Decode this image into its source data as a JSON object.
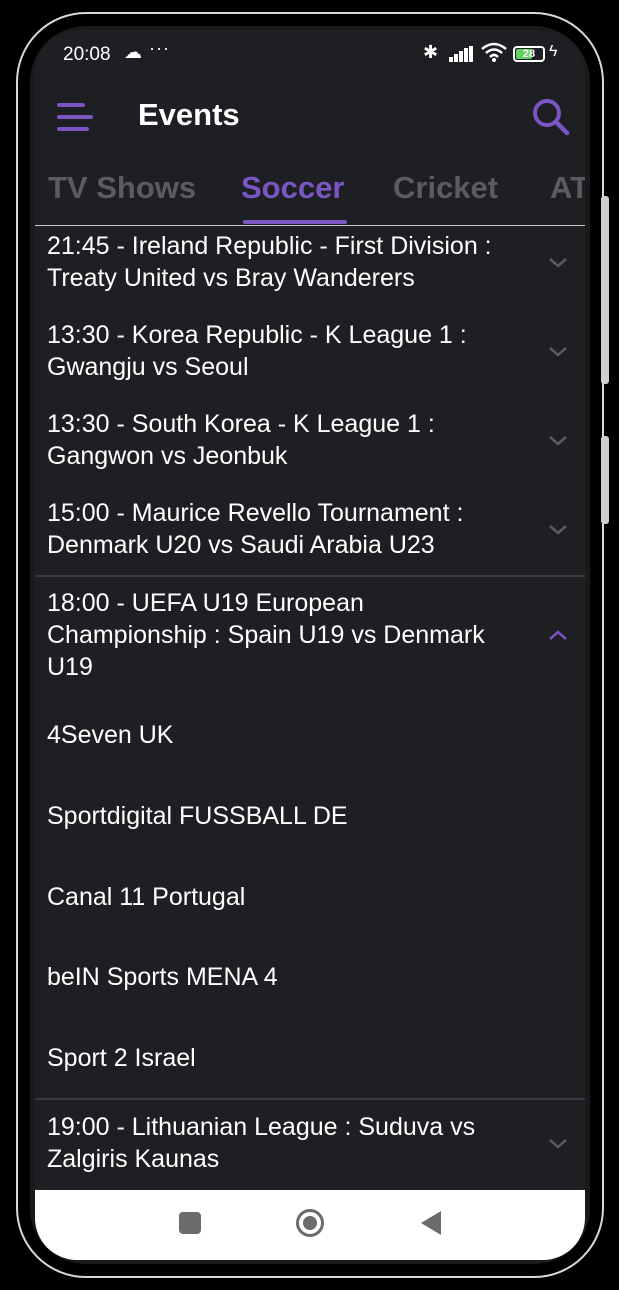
{
  "status_bar": {
    "time": "20:08",
    "cloud_icon": "☁",
    "more_dots": "···",
    "battery": "28",
    "bluetooth_icon": "✱",
    "charging_icon": "ϟ"
  },
  "app_bar": {
    "title": "Events"
  },
  "tabs": [
    {
      "label": "TV Shows"
    },
    {
      "label": "Soccer",
      "active": true
    },
    {
      "label": "Cricket"
    },
    {
      "label": "AT"
    }
  ],
  "events": [
    {
      "title": "21:45 - Ireland Republic - First Division : Treaty United vs Bray Wanderers",
      "expanded": false
    },
    {
      "title": "13:30 - Korea Republic - K League 1 : Gwangju vs Seoul",
      "expanded": false
    },
    {
      "title": "13:30 - South Korea - K League 1 : Gangwon vs Jeonbuk",
      "expanded": false
    },
    {
      "title": "15:00 - Maurice Revello Tournament : Denmark U20 vs Saudi Arabia U23",
      "expanded": false
    },
    {
      "title": "18:00 - UEFA U19 European Championship : Spain U19 vs Denmark U19",
      "expanded": true,
      "channels": [
        "4Seven UK",
        "Sportdigital FUSSBALL DE",
        "Canal 11 Portugal",
        "beIN Sports MENA 4",
        "Sport 2 Israel"
      ]
    },
    {
      "title": "19:00 - Lithuanian League : Suduva vs Zalgiris Kaunas",
      "expanded": false
    }
  ],
  "colors": {
    "accent": "#7b55c4",
    "background": "#1e1f23",
    "inactive_tab": "#5b5c61"
  }
}
